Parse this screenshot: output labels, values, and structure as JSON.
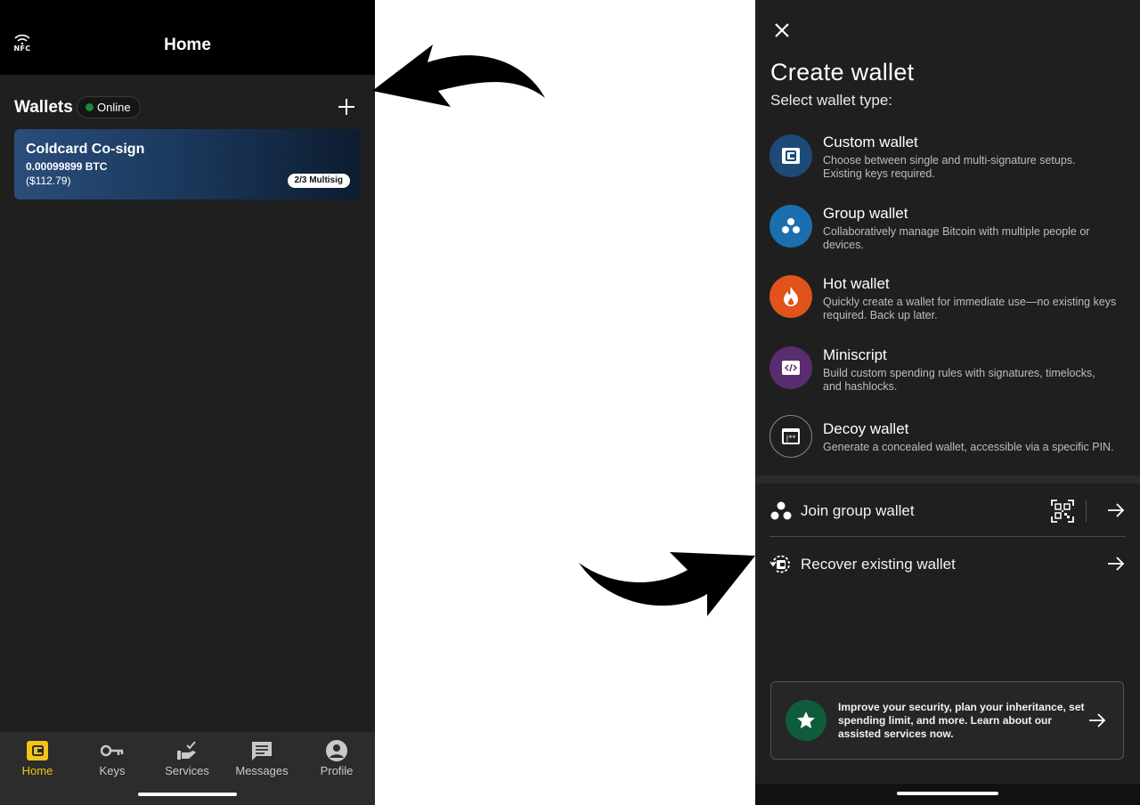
{
  "home": {
    "nfc_label": "NFC",
    "title": "Home",
    "wallets_title": "Wallets",
    "online_label": "Online",
    "wallet": {
      "name": "Coldcard Co-sign",
      "btc": "0.00099899 BTC",
      "usd": "($112.79)",
      "badge": "2/3 Multisig"
    },
    "nav": [
      {
        "label": "Home",
        "icon": "wallet-icon",
        "active": true
      },
      {
        "label": "Keys",
        "icon": "key-icon",
        "active": false
      },
      {
        "label": "Services",
        "icon": "services-icon",
        "active": false
      },
      {
        "label": "Messages",
        "icon": "message-icon",
        "active": false
      },
      {
        "label": "Profile",
        "icon": "profile-icon",
        "active": false
      }
    ]
  },
  "create": {
    "title": "Create wallet",
    "subtitle": "Select wallet type:",
    "types": [
      {
        "title": "Custom wallet",
        "desc": "Choose between single and multi-signature setups. Existing keys required.",
        "icon": "custom-wallet-icon",
        "color": "#1e4a78"
      },
      {
        "title": "Group wallet",
        "desc": "Collaboratively manage Bitcoin with multiple people or devices.",
        "icon": "group-wallet-icon",
        "color": "#1b6fae"
      },
      {
        "title": "Hot wallet",
        "desc": "Quickly create a wallet for immediate use—no existing keys required. Back up later.",
        "icon": "flame-icon",
        "color": "#e0531a"
      },
      {
        "title": "Miniscript",
        "desc": "Build custom spending rules with signatures, timelocks, and hashlocks.",
        "icon": "code-icon",
        "color": "#5a2d6e"
      },
      {
        "title": "Decoy wallet",
        "desc": "Generate a concealed wallet, accessible via a specific PIN.",
        "icon": "decoy-wallet-icon",
        "color": "#1f1f20"
      }
    ],
    "join_label": "Join group wallet",
    "recover_label": "Recover existing wallet",
    "promo_text": "Improve your security, plan your inheritance, set spending limit, and more. Learn about our assisted services now."
  },
  "colors": {
    "accent": "#f0c419",
    "online": "#1a8a3c",
    "promo": "#0f5c3a"
  }
}
